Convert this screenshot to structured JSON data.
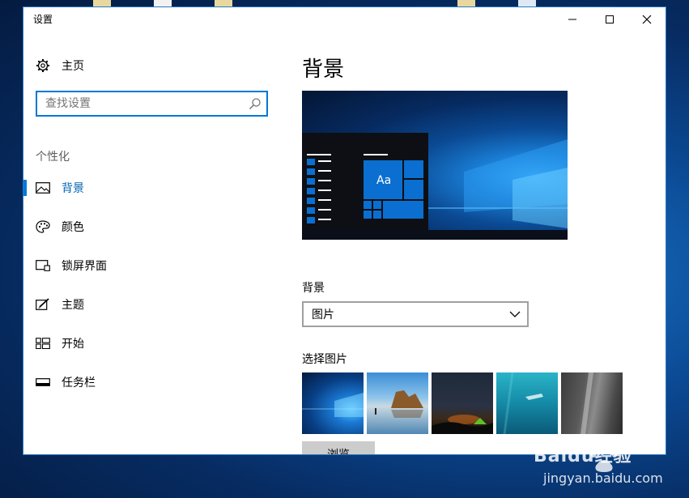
{
  "window": {
    "title": "设置",
    "minimize_label": "—",
    "maximize_label": "☐",
    "close_label": "✕"
  },
  "sidebar": {
    "home_label": "主页",
    "home_icon": "gear-icon",
    "search_placeholder": "查找设置",
    "search_icon": "search-icon",
    "section_label": "个性化",
    "items": [
      {
        "label": "背景",
        "icon": "picture-icon",
        "active": true
      },
      {
        "label": "颜色",
        "icon": "palette-icon",
        "active": false
      },
      {
        "label": "锁屏界面",
        "icon": "lock-screen-icon",
        "active": false
      },
      {
        "label": "主题",
        "icon": "theme-brush-icon",
        "active": false
      },
      {
        "label": "开始",
        "icon": "start-grid-icon",
        "active": false
      },
      {
        "label": "任务栏",
        "icon": "taskbar-icon",
        "active": false
      }
    ]
  },
  "main": {
    "title": "背景",
    "preview_tile_text": "Aa",
    "background_label": "背景",
    "background_value": "图片",
    "choose_picture_label": "选择图片",
    "browse_label": "浏览"
  },
  "watermark": {
    "brand": "Baidu经验",
    "url": "jingyan.baidu.com"
  },
  "colors": {
    "accent": "#0078d7",
    "accent_text": "#0063b1",
    "select_border": "#a0a0a0",
    "browse_bg": "#cccccc"
  }
}
